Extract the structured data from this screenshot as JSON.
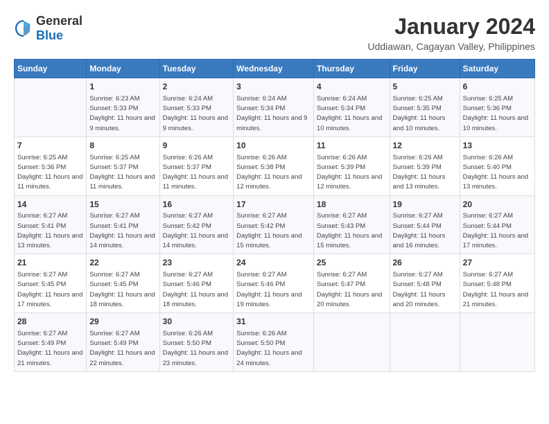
{
  "header": {
    "logo_general": "General",
    "logo_blue": "Blue",
    "month_year": "January 2024",
    "location": "Uddiawan, Cagayan Valley, Philippines"
  },
  "days_of_week": [
    "Sunday",
    "Monday",
    "Tuesday",
    "Wednesday",
    "Thursday",
    "Friday",
    "Saturday"
  ],
  "weeks": [
    [
      {
        "day": "",
        "sunrise": "",
        "sunset": "",
        "daylight": ""
      },
      {
        "day": "1",
        "sunrise": "Sunrise: 6:23 AM",
        "sunset": "Sunset: 5:33 PM",
        "daylight": "Daylight: 11 hours and 9 minutes."
      },
      {
        "day": "2",
        "sunrise": "Sunrise: 6:24 AM",
        "sunset": "Sunset: 5:33 PM",
        "daylight": "Daylight: 11 hours and 9 minutes."
      },
      {
        "day": "3",
        "sunrise": "Sunrise: 6:24 AM",
        "sunset": "Sunset: 5:34 PM",
        "daylight": "Daylight: 11 hours and 9 minutes."
      },
      {
        "day": "4",
        "sunrise": "Sunrise: 6:24 AM",
        "sunset": "Sunset: 5:34 PM",
        "daylight": "Daylight: 11 hours and 10 minutes."
      },
      {
        "day": "5",
        "sunrise": "Sunrise: 6:25 AM",
        "sunset": "Sunset: 5:35 PM",
        "daylight": "Daylight: 11 hours and 10 minutes."
      },
      {
        "day": "6",
        "sunrise": "Sunrise: 6:25 AM",
        "sunset": "Sunset: 5:36 PM",
        "daylight": "Daylight: 11 hours and 10 minutes."
      }
    ],
    [
      {
        "day": "7",
        "sunrise": "Sunrise: 6:25 AM",
        "sunset": "Sunset: 5:36 PM",
        "daylight": "Daylight: 11 hours and 11 minutes."
      },
      {
        "day": "8",
        "sunrise": "Sunrise: 6:25 AM",
        "sunset": "Sunset: 5:37 PM",
        "daylight": "Daylight: 11 hours and 11 minutes."
      },
      {
        "day": "9",
        "sunrise": "Sunrise: 6:26 AM",
        "sunset": "Sunset: 5:37 PM",
        "daylight": "Daylight: 11 hours and 11 minutes."
      },
      {
        "day": "10",
        "sunrise": "Sunrise: 6:26 AM",
        "sunset": "Sunset: 5:38 PM",
        "daylight": "Daylight: 11 hours and 12 minutes."
      },
      {
        "day": "11",
        "sunrise": "Sunrise: 6:26 AM",
        "sunset": "Sunset: 5:39 PM",
        "daylight": "Daylight: 11 hours and 12 minutes."
      },
      {
        "day": "12",
        "sunrise": "Sunrise: 6:26 AM",
        "sunset": "Sunset: 5:39 PM",
        "daylight": "Daylight: 11 hours and 13 minutes."
      },
      {
        "day": "13",
        "sunrise": "Sunrise: 6:26 AM",
        "sunset": "Sunset: 5:40 PM",
        "daylight": "Daylight: 11 hours and 13 minutes."
      }
    ],
    [
      {
        "day": "14",
        "sunrise": "Sunrise: 6:27 AM",
        "sunset": "Sunset: 5:41 PM",
        "daylight": "Daylight: 11 hours and 13 minutes."
      },
      {
        "day": "15",
        "sunrise": "Sunrise: 6:27 AM",
        "sunset": "Sunset: 5:41 PM",
        "daylight": "Daylight: 11 hours and 14 minutes."
      },
      {
        "day": "16",
        "sunrise": "Sunrise: 6:27 AM",
        "sunset": "Sunset: 5:42 PM",
        "daylight": "Daylight: 11 hours and 14 minutes."
      },
      {
        "day": "17",
        "sunrise": "Sunrise: 6:27 AM",
        "sunset": "Sunset: 5:42 PM",
        "daylight": "Daylight: 11 hours and 15 minutes."
      },
      {
        "day": "18",
        "sunrise": "Sunrise: 6:27 AM",
        "sunset": "Sunset: 5:43 PM",
        "daylight": "Daylight: 11 hours and 15 minutes."
      },
      {
        "day": "19",
        "sunrise": "Sunrise: 6:27 AM",
        "sunset": "Sunset: 5:44 PM",
        "daylight": "Daylight: 11 hours and 16 minutes."
      },
      {
        "day": "20",
        "sunrise": "Sunrise: 6:27 AM",
        "sunset": "Sunset: 5:44 PM",
        "daylight": "Daylight: 11 hours and 17 minutes."
      }
    ],
    [
      {
        "day": "21",
        "sunrise": "Sunrise: 6:27 AM",
        "sunset": "Sunset: 5:45 PM",
        "daylight": "Daylight: 11 hours and 17 minutes."
      },
      {
        "day": "22",
        "sunrise": "Sunrise: 6:27 AM",
        "sunset": "Sunset: 5:45 PM",
        "daylight": "Daylight: 11 hours and 18 minutes."
      },
      {
        "day": "23",
        "sunrise": "Sunrise: 6:27 AM",
        "sunset": "Sunset: 5:46 PM",
        "daylight": "Daylight: 11 hours and 18 minutes."
      },
      {
        "day": "24",
        "sunrise": "Sunrise: 6:27 AM",
        "sunset": "Sunset: 5:46 PM",
        "daylight": "Daylight: 11 hours and 19 minutes."
      },
      {
        "day": "25",
        "sunrise": "Sunrise: 6:27 AM",
        "sunset": "Sunset: 5:47 PM",
        "daylight": "Daylight: 11 hours and 20 minutes."
      },
      {
        "day": "26",
        "sunrise": "Sunrise: 6:27 AM",
        "sunset": "Sunset: 5:48 PM",
        "daylight": "Daylight: 11 hours and 20 minutes."
      },
      {
        "day": "27",
        "sunrise": "Sunrise: 6:27 AM",
        "sunset": "Sunset: 5:48 PM",
        "daylight": "Daylight: 11 hours and 21 minutes."
      }
    ],
    [
      {
        "day": "28",
        "sunrise": "Sunrise: 6:27 AM",
        "sunset": "Sunset: 5:49 PM",
        "daylight": "Daylight: 11 hours and 21 minutes."
      },
      {
        "day": "29",
        "sunrise": "Sunrise: 6:27 AM",
        "sunset": "Sunset: 5:49 PM",
        "daylight": "Daylight: 11 hours and 22 minutes."
      },
      {
        "day": "30",
        "sunrise": "Sunrise: 6:26 AM",
        "sunset": "Sunset: 5:50 PM",
        "daylight": "Daylight: 11 hours and 23 minutes."
      },
      {
        "day": "31",
        "sunrise": "Sunrise: 6:26 AM",
        "sunset": "Sunset: 5:50 PM",
        "daylight": "Daylight: 11 hours and 24 minutes."
      },
      {
        "day": "",
        "sunrise": "",
        "sunset": "",
        "daylight": ""
      },
      {
        "day": "",
        "sunrise": "",
        "sunset": "",
        "daylight": ""
      },
      {
        "day": "",
        "sunrise": "",
        "sunset": "",
        "daylight": ""
      }
    ]
  ]
}
